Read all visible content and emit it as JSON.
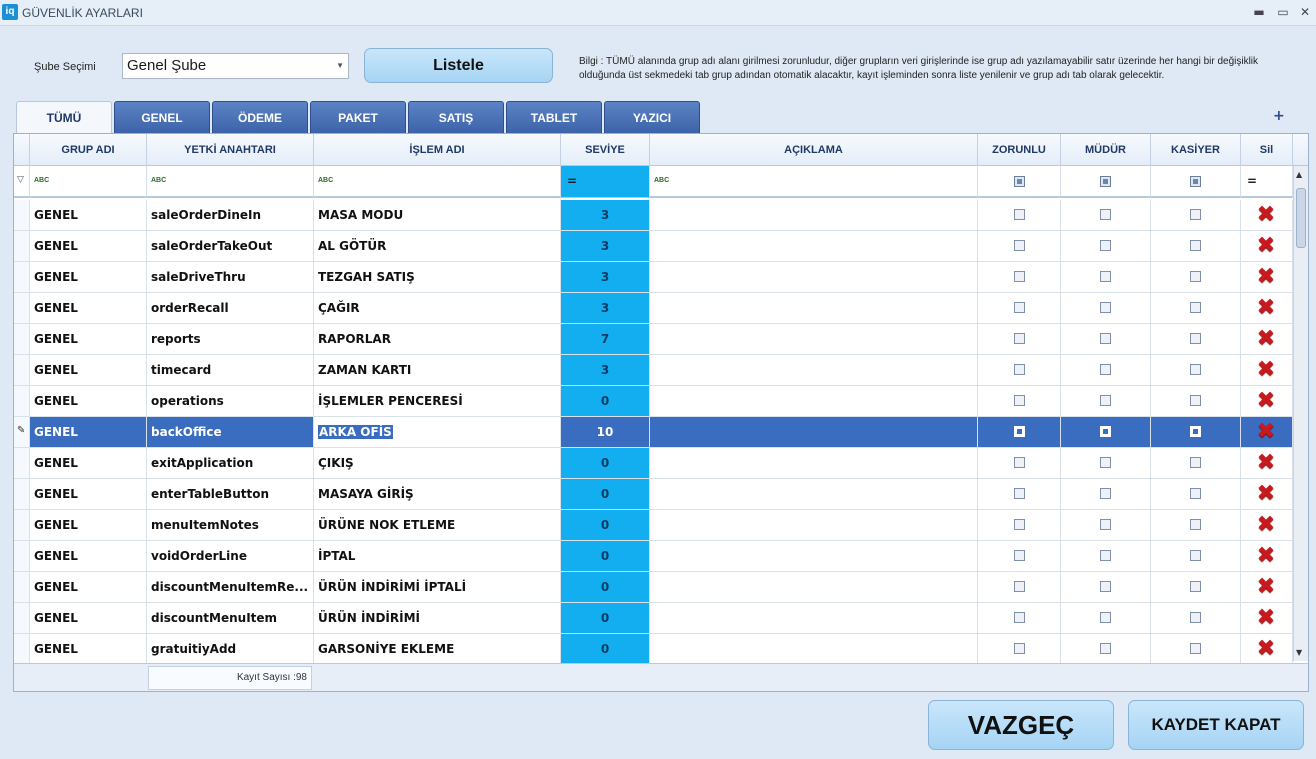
{
  "window": {
    "app_icon": "iq",
    "title": "GÜVENLİK AYARLARI",
    "minimize": "▬",
    "maximize": "▭",
    "close": "✕"
  },
  "branch": {
    "label": "Şube Seçimi",
    "selected": "Genel Şube"
  },
  "list_button": "Listele",
  "info": "Bilgi : TÜMÜ alanında grup adı alanı girilmesi zorunludur, diğer grupların veri girişlerinde ise grup adı yazılamayabilir satır üzerinde her hangi bir değişiklik olduğunda üst sekmedeki tab grup adından otomatik alacaktır, kayıt işleminden sonra liste yenilenir ve grup adı tab olarak gelecektir.",
  "tabs": [
    "TÜMÜ",
    "GENEL",
    "ÖDEME",
    "PAKET",
    "SATIŞ",
    "TABLET",
    "YAZICI"
  ],
  "add_tab": "+",
  "columns": {
    "group": "GRUP ADI",
    "key": "YETKİ ANAHTARI",
    "op": "İŞLEM ADI",
    "level": "SEVİYE",
    "desc": "AÇIKLAMA",
    "required": "ZORUNLU",
    "manager": "MÜDÜR",
    "cashier": "KASİYER",
    "delete": "Sil"
  },
  "filter": {
    "text_icon": "ABC",
    "equals": "="
  },
  "rows": [
    {
      "group": "GENEL",
      "key": "saleOrderDineIn",
      "op": "MASA MODU",
      "level": "3"
    },
    {
      "group": "GENEL",
      "key": "saleOrderTakeOut",
      "op": "AL GÖTÜR",
      "level": "3"
    },
    {
      "group": "GENEL",
      "key": "saleDriveThru",
      "op": "TEZGAH SATIŞ",
      "level": "3"
    },
    {
      "group": "GENEL",
      "key": "orderRecall",
      "op": "ÇAĞIR",
      "level": "3"
    },
    {
      "group": "GENEL",
      "key": "reports",
      "op": "RAPORLAR",
      "level": "7"
    },
    {
      "group": "GENEL",
      "key": "timecard",
      "op": "ZAMAN KARTI",
      "level": "3"
    },
    {
      "group": "GENEL",
      "key": "operations",
      "op": "İŞLEMLER PENCERESİ",
      "level": "0"
    },
    {
      "group": "GENEL",
      "key": "backOffice",
      "op": "ARKA OFİS",
      "level": "10"
    },
    {
      "group": "GENEL",
      "key": "exitApplication",
      "op": "ÇIKIŞ",
      "level": "0"
    },
    {
      "group": "GENEL",
      "key": "enterTableButton",
      "op": "MASAYA GİRİŞ",
      "level": "0"
    },
    {
      "group": "GENEL",
      "key": "menuItemNotes",
      "op": "ÜRÜNE NOK ETLEME",
      "level": "0"
    },
    {
      "group": "GENEL",
      "key": "voidOrderLine",
      "op": "İPTAL",
      "level": "0"
    },
    {
      "group": "GENEL",
      "key": "discountMenuItemRe...",
      "op": "ÜRÜN İNDİRİMİ İPTALİ",
      "level": "0"
    },
    {
      "group": "GENEL",
      "key": "discountMenuItem",
      "op": "ÜRÜN İNDİRİMİ",
      "level": "0"
    },
    {
      "group": "GENEL",
      "key": "gratuitiyAdd",
      "op": "GARSONİYE EKLEME",
      "level": "0"
    }
  ],
  "selected_row_index": 7,
  "record_count": "Kayıt Sayısı :98",
  "buttons": {
    "cancel": "VAZGEÇ",
    "save_close": "KAYDET KAPAT"
  },
  "colors": {
    "accent": "#3a6cc0",
    "level_bg": "#12aef0",
    "delete": "#c8191e"
  }
}
